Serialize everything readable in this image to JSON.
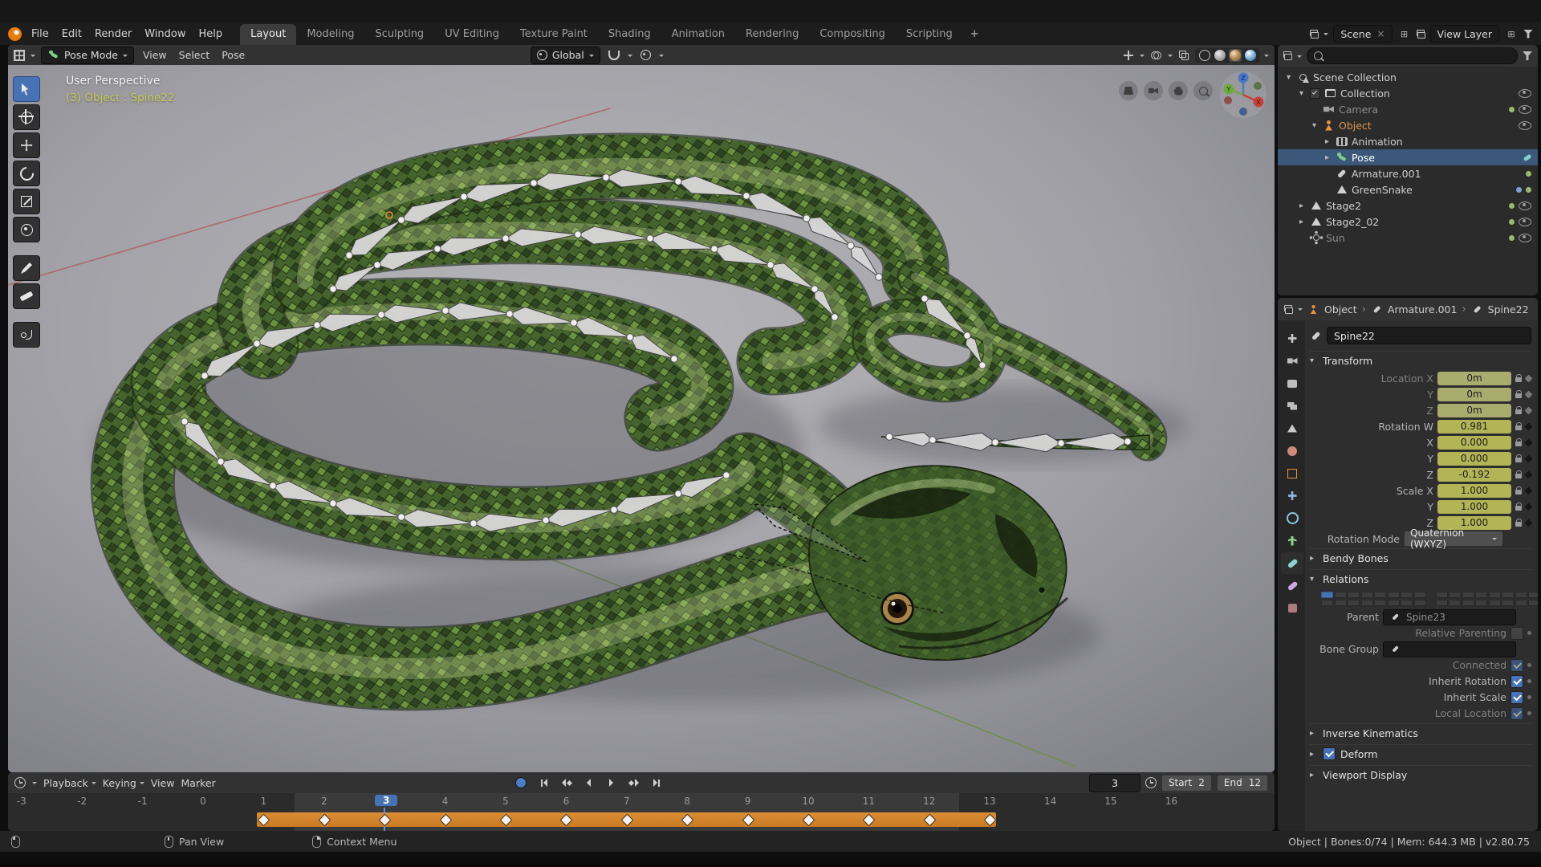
{
  "topbar": {
    "menus": [
      "File",
      "Edit",
      "Render",
      "Window",
      "Help"
    ],
    "tabs": [
      "Layout",
      "Modeling",
      "Sculpting",
      "UV Editing",
      "Texture Paint",
      "Shading",
      "Animation",
      "Rendering",
      "Compositing",
      "Scripting"
    ],
    "active_tab": "Layout",
    "add_tab_label": "+",
    "scene_name": "Scene",
    "view_layer_name": "View Layer"
  },
  "viewport": {
    "mode": "Pose Mode",
    "menus": [
      "View",
      "Select",
      "Pose"
    ],
    "orientation": "Global",
    "overlay": {
      "line1": "User Perspective",
      "line2": "(3) Object : Spine22"
    },
    "gizmo": {
      "x": "X",
      "y": "Y",
      "z": "Z"
    }
  },
  "outliner": {
    "rows": [
      {
        "label": "Scene Collection",
        "depth": 0,
        "icon": "scene",
        "arrow": "down"
      },
      {
        "label": "Collection",
        "depth": 1,
        "icon": "collection",
        "arrow": "down",
        "checkbox": true,
        "eye": true
      },
      {
        "label": "Camera",
        "depth": 2,
        "icon": "camera",
        "grayed": true,
        "eye": true,
        "extra": [
          "data"
        ]
      },
      {
        "label": "Object",
        "depth": 2,
        "icon": "object",
        "active": true,
        "arrow": "down",
        "eye": true
      },
      {
        "label": "Animation",
        "depth": 3,
        "icon": "animation",
        "arrow": "right"
      },
      {
        "label": "Pose",
        "depth": 3,
        "icon": "pose",
        "highlight": true,
        "arrow": "right",
        "extra": [
          "bone"
        ]
      },
      {
        "label": "Armature.001",
        "depth": 3,
        "icon": "armature",
        "extra": [
          "data"
        ]
      },
      {
        "label": "GreenSnake",
        "depth": 3,
        "icon": "mesh",
        "extra": [
          "modifier",
          "data"
        ]
      },
      {
        "label": "Stage2",
        "depth": 1,
        "icon": "mesh",
        "arrow": "right",
        "eye": true,
        "extra": [
          "data"
        ]
      },
      {
        "label": "Stage2_02",
        "depth": 1,
        "icon": "mesh",
        "arrow": "right",
        "eye": true,
        "extra": [
          "data"
        ]
      },
      {
        "label": "Sun",
        "depth": 1,
        "icon": "sun",
        "grayed": true,
        "eye": true,
        "extra": [
          "data"
        ]
      }
    ]
  },
  "properties": {
    "breadcrumb": [
      "Object",
      "Armature.001",
      "Spine22"
    ],
    "name": "Spine22",
    "transform": {
      "title": "Transform",
      "rows": [
        {
          "label": "Location X",
          "value": "0m",
          "state": "loc"
        },
        {
          "label": "Y",
          "value": "0m",
          "state": "loc"
        },
        {
          "label": "Z",
          "value": "0m",
          "state": "loc"
        },
        {
          "label": "Rotation W",
          "value": "0.981",
          "state": "rot"
        },
        {
          "label": "X",
          "value": "0.000",
          "state": "rot"
        },
        {
          "label": "Y",
          "value": "0.000",
          "state": "rot"
        },
        {
          "label": "Z",
          "value": "-0.192",
          "state": "rot"
        },
        {
          "label": "Scale X",
          "value": "1.000",
          "state": "rot"
        },
        {
          "label": "Y",
          "value": "1.000",
          "state": "rot"
        },
        {
          "label": "Z",
          "value": "1.000",
          "state": "rot"
        }
      ],
      "rotation_mode_label": "Rotation Mode",
      "rotation_mode_value": "Quaternion (WXYZ)"
    },
    "sections": {
      "bendy_bones": "Bendy Bones",
      "relations": "Relations",
      "inverse_kinematics": "Inverse Kinematics",
      "deform": "Deform",
      "viewport_display": "Viewport Display"
    },
    "deform_checked": true,
    "relations": {
      "parent_label": "Parent",
      "parent_value": "Spine23",
      "relative_parenting_label": "Relative Parenting",
      "bone_group_label": "Bone Group",
      "toggles": [
        {
          "label": "Connected",
          "checked": true,
          "disabled": true
        },
        {
          "label": "Inherit Rotation",
          "checked": true,
          "disabled": false
        },
        {
          "label": "Inherit Scale",
          "checked": true,
          "disabled": false
        },
        {
          "label": "Local Location",
          "checked": true,
          "disabled": true
        }
      ]
    }
  },
  "timeline": {
    "menus": [
      "Playback",
      "Keying",
      "View",
      "Marker"
    ],
    "current_frame": "3",
    "start_label": "Start",
    "start_value": "2",
    "end_label": "End",
    "end_value": "12",
    "ruler": [
      -3,
      -2,
      -1,
      0,
      1,
      2,
      3,
      4,
      5,
      6,
      7,
      8,
      9,
      10,
      11,
      12,
      13,
      14,
      15,
      16
    ],
    "keyframes": [
      1,
      2,
      3,
      4,
      5,
      6,
      7,
      8,
      9,
      10,
      11,
      12,
      13
    ],
    "current": 3,
    "range_start": 2,
    "range_end": 12
  },
  "statusbar": {
    "hints": [
      {
        "label": "Pan View",
        "button": "middle"
      },
      {
        "label": "Context Menu",
        "button": "right"
      }
    ],
    "info": "Object | Bones:0/74 | Mem: 644.3 MB | v2.80.75"
  }
}
